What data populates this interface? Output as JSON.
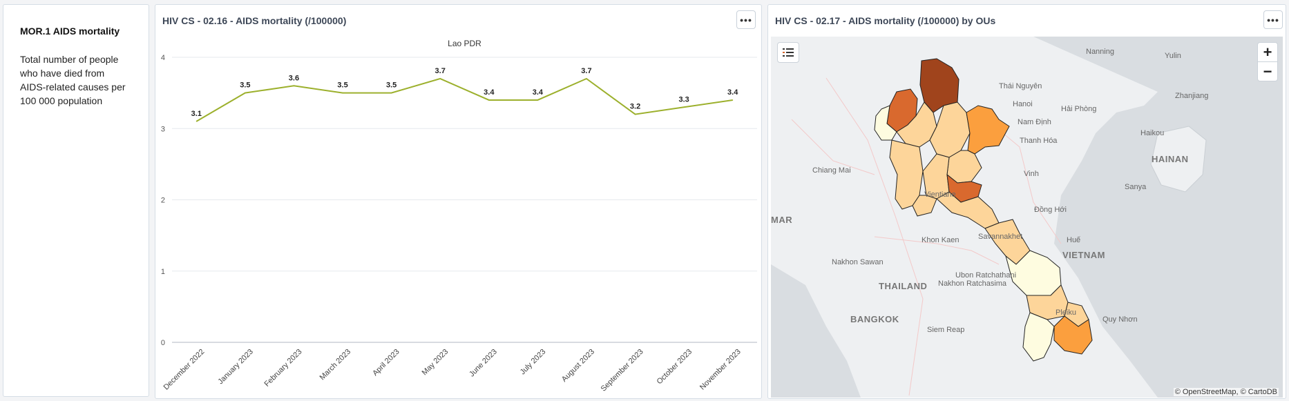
{
  "info": {
    "title": "MOR.1 AIDS mortality",
    "description": "Total number of people who have died from AIDS-related causes per 100 000 population"
  },
  "chart_panel": {
    "title": "HIV CS - 02.16 - AIDS mortality (/100000)",
    "menu": "•••"
  },
  "chart_data": {
    "type": "line",
    "title": "Lao PDR",
    "categories": [
      "December 2022",
      "January 2023",
      "February 2023",
      "March 2023",
      "April 2023",
      "May 2023",
      "June 2023",
      "July 2023",
      "August 2023",
      "September 2023",
      "October 2023",
      "November 2023"
    ],
    "values": [
      3.1,
      3.5,
      3.6,
      3.5,
      3.5,
      3.7,
      3.4,
      3.4,
      3.7,
      3.2,
      3.3,
      3.4
    ],
    "ylim": [
      0,
      4
    ],
    "yticks": [
      "0",
      "1",
      "2",
      "3",
      "4"
    ],
    "grid": true,
    "color": "#9cb02c"
  },
  "map_panel": {
    "title": "HIV CS - 02.17 - AIDS mortality (/100000) by OUs",
    "menu": "•••",
    "zoom_in": "+",
    "zoom_out": "−",
    "attribution": "© OpenStreetMap, © CartoDB",
    "legend_icon": "list-icon",
    "cities": [
      {
        "name": "Nanning",
        "big": false
      },
      {
        "name": "Yulin",
        "big": false
      },
      {
        "name": "Thái Nguyên",
        "big": false
      },
      {
        "name": "Zhanjiang",
        "big": false
      },
      {
        "name": "Hanoi",
        "big": false
      },
      {
        "name": "Hải Phòng",
        "big": false
      },
      {
        "name": "Nam Định",
        "big": false
      },
      {
        "name": "Haikou",
        "big": false
      },
      {
        "name": "Thanh Hóa",
        "big": false
      },
      {
        "name": "HAINAN",
        "big": true
      },
      {
        "name": "Chiang Mai",
        "big": false
      },
      {
        "name": "Vinh",
        "big": false
      },
      {
        "name": "Sanya",
        "big": false
      },
      {
        "name": "Vientiane",
        "big": false
      },
      {
        "name": "MAR",
        "big": true
      },
      {
        "name": "Đồng Hới",
        "big": false
      },
      {
        "name": "Savannakhet",
        "big": false
      },
      {
        "name": "Khon Kaen",
        "big": false
      },
      {
        "name": "Huế",
        "big": false
      },
      {
        "name": "VIETNAM",
        "big": true
      },
      {
        "name": "Nakhon Sawan",
        "big": false
      },
      {
        "name": "Ubon Ratchathani",
        "big": false
      },
      {
        "name": "THAILAND",
        "big": true
      },
      {
        "name": "Nakhon Ratchasima",
        "big": false
      },
      {
        "name": "Pleiku",
        "big": false
      },
      {
        "name": "BANGKOK",
        "big": true
      },
      {
        "name": "Quy Nhơn",
        "big": false
      },
      {
        "name": "Siem Reap",
        "big": false
      }
    ],
    "colors": {
      "darkest": "#a0441c",
      "dark": "#d9692e",
      "mid": "#fb9f3e",
      "light": "#fdd59a",
      "lightest": "#fefce0"
    }
  }
}
